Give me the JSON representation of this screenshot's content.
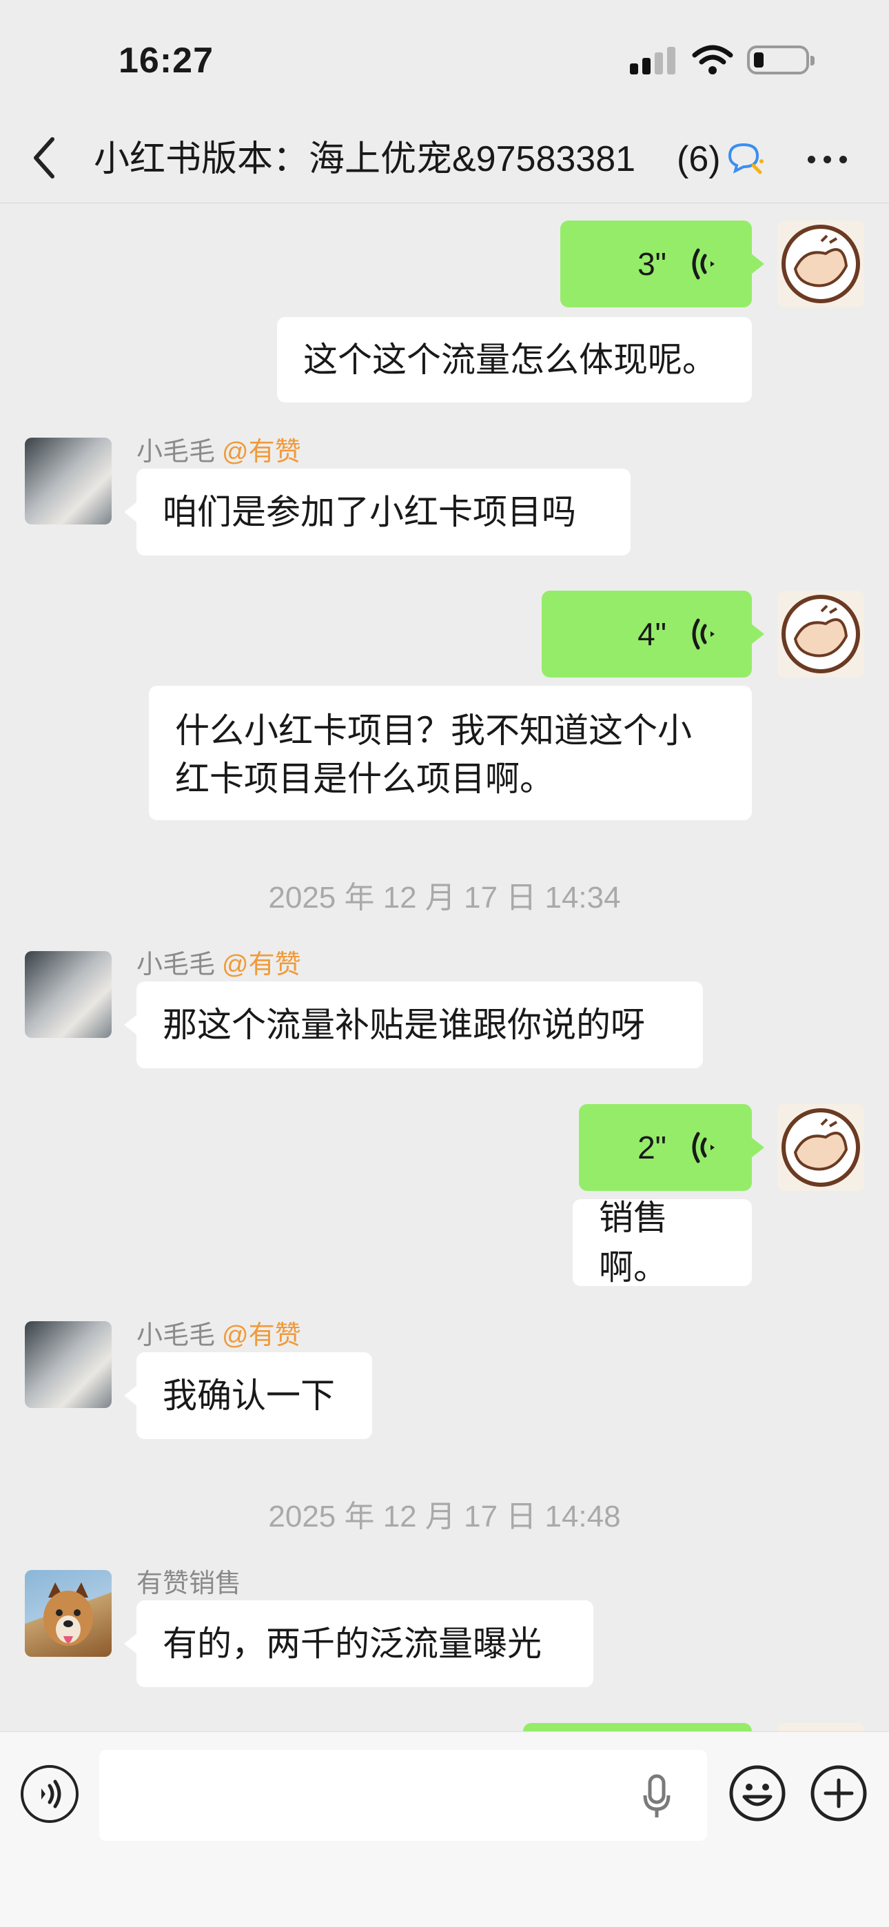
{
  "status_bar": {
    "time": "16:27"
  },
  "nav": {
    "title": "小红书版本：海上优宠&97583381",
    "member_count": "(6)"
  },
  "messages": [
    {
      "side": "self",
      "type": "voice",
      "duration": "3\""
    },
    {
      "side": "self",
      "type": "text",
      "text": "这个这个流量怎么体现呢。"
    },
    {
      "side": "other",
      "sender": "小毛毛",
      "mention": "@有赞",
      "avatar": "cat-avatar",
      "type": "text",
      "text": "咱们是参加了小红卡项目吗"
    },
    {
      "side": "self",
      "type": "voice",
      "duration": "4\""
    },
    {
      "side": "self",
      "type": "text",
      "lines": [
        "什么小红卡项目？我不知道这个小",
        "红卡项目是什么项目啊。"
      ]
    },
    {
      "side": "system",
      "type": "timestamp",
      "text": "2025 年 12 月 17 日 14:34"
    },
    {
      "side": "other",
      "sender": "小毛毛",
      "mention": "@有赞",
      "avatar": "cat-avatar",
      "type": "text",
      "text": "那这个流量补贴是谁跟你说的呀"
    },
    {
      "side": "self",
      "type": "voice",
      "duration": "2\""
    },
    {
      "side": "self",
      "type": "text",
      "text": "销售啊。"
    },
    {
      "side": "other",
      "sender": "小毛毛",
      "mention": "@有赞",
      "avatar": "cat-avatar",
      "type": "text",
      "text": "我确认一下"
    },
    {
      "side": "system",
      "type": "timestamp",
      "text": "2025 年 12 月 17 日 14:48"
    },
    {
      "side": "other",
      "sender": "有赞销售",
      "avatar": "dog-avatar",
      "type": "text",
      "text": "有的，两千的泛流量曝光"
    }
  ],
  "input": {
    "placeholder": ""
  },
  "colors": {
    "self_bubble": "#95ec69",
    "other_bubble": "#ffffff",
    "background": "#ededed",
    "mention": "#f09a3a"
  }
}
